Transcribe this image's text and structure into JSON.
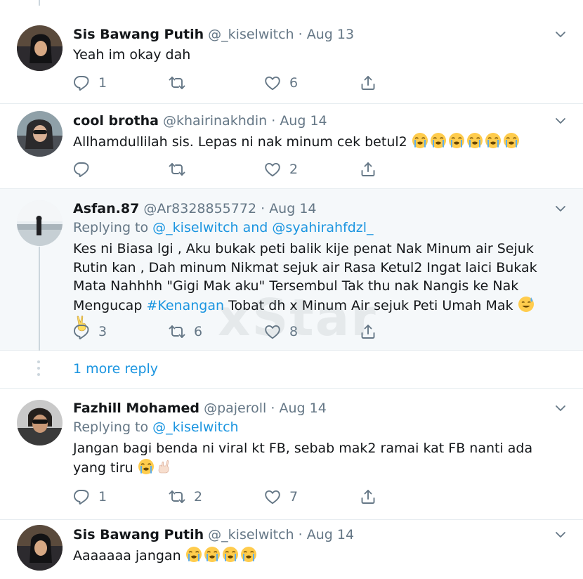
{
  "tweets": [
    {
      "name": "Sis Bawang Putih",
      "handle": "@_kiselwitch",
      "dot": "·",
      "date": "Aug 13",
      "text": "Yeah im okay dah",
      "replies": "1",
      "retweets": "",
      "likes": "6"
    },
    {
      "name": "cool brotha",
      "handle": "@khairinakhdin",
      "dot": "·",
      "date": "Aug 14",
      "text": "Allhamdullilah sis. Lepas ni nak minum cek betul2",
      "replies": "",
      "retweets": "",
      "likes": "2"
    },
    {
      "name": "Asfan.87",
      "handle": "@Ar8328855772",
      "dot": "·",
      "date": "Aug 14",
      "replying_prefix": "Replying to",
      "replying_mention_1": "@_kiselwitch",
      "replying_and": "and",
      "replying_mention_2": "@syahirahfdzl_",
      "text": "Kes ni Biasa lgi , Aku bukak peti balik kije penat Nak Minum air Sejuk Rutin kan , Dah minum Nikmat sejuk air Rasa Ketul2 Ingat laici Bukak Mata Nahhhh \"Gigi Mak aku\" Tersembul Tak thu nak Nangis ke Nak Mengucap",
      "hashtag": "#Kenangan",
      "text_after": "Tobat dh x Minum Air sejuk Peti Umah Mak",
      "replies": "3",
      "retweets": "6",
      "likes": "8"
    },
    {
      "name": "Fazhill Mohamed",
      "handle": "@pajeroll",
      "dot": "·",
      "date": "Aug 14",
      "replying_prefix": "Replying to",
      "replying_mention_1": "@_kiselwitch",
      "text": "Jangan bagi benda ni viral kt FB, sebab mak2 ramai kat FB nanti ada yang tiru",
      "replies": "1",
      "retweets": "2",
      "likes": "7"
    },
    {
      "name": "Sis Bawang Putih",
      "handle": "@_kiselwitch",
      "dot": "·",
      "date": "Aug 14",
      "text": "Aaaaaaa jangan"
    }
  ],
  "more_reply_label": "1 more reply",
  "watermark": "xStar",
  "icons": {
    "reply": "reply-icon",
    "retweet": "retweet-icon",
    "like": "heart-icon",
    "share": "share-icon",
    "caret": "chevron-down-icon"
  },
  "colors": {
    "link": "#1b95e0",
    "muted": "#657786",
    "highlight_bg": "#f5f8fa"
  }
}
